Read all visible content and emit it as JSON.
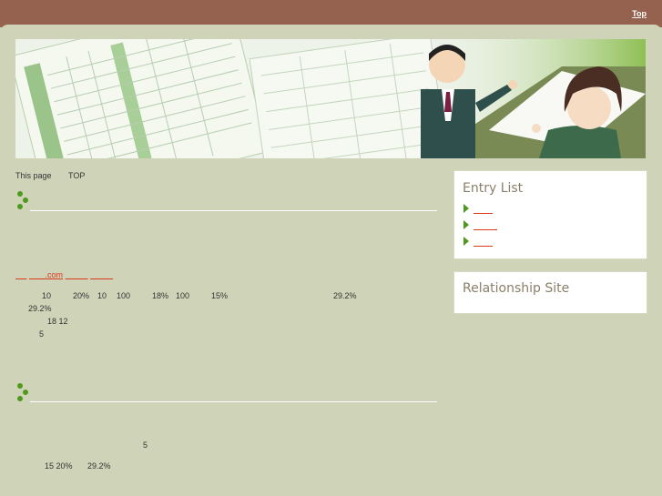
{
  "header": {
    "top_link": "Top"
  },
  "breadcrumb": {
    "label": "This page",
    "current": "TOP"
  },
  "article1": {
    "link_suffix": ".com",
    "line1": [
      "10",
      "20%",
      "10",
      "100",
      "18%",
      "100",
      "15%",
      "29.2%"
    ],
    "line2": "29.2%",
    "line3": "18 12",
    "line4": "5"
  },
  "article2": {
    "line1": "5",
    "line2": "15 20%",
    "line3": "29.2%"
  },
  "sidebar": {
    "entry_list_title": "Entry List",
    "relationship_title": "Relationship Site"
  },
  "colors": {
    "header_bg": "#94624e",
    "page_bg": "#cfd4b8",
    "accent_green": "#4f9a1e",
    "link_red": "#d83a1e"
  }
}
